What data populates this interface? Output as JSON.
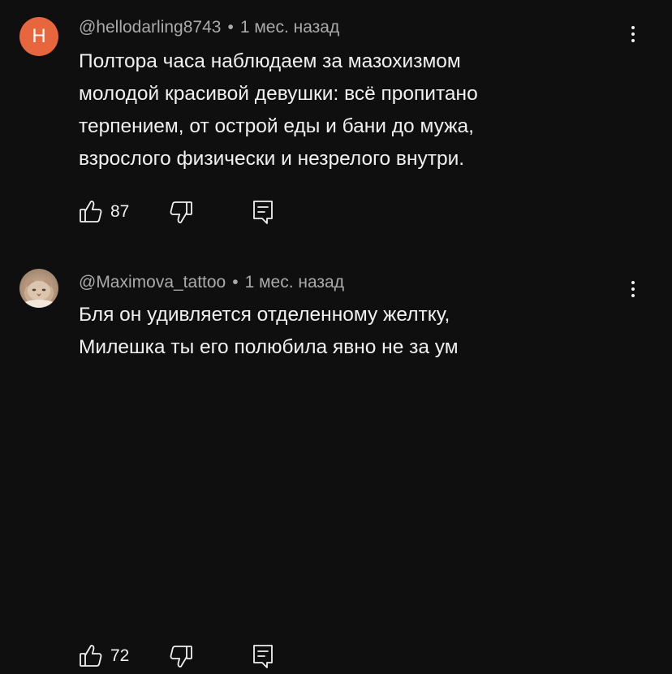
{
  "comments": [
    {
      "avatar_letter": "H",
      "avatar_color": "#e8663d",
      "author": "@hellodarling8743",
      "separator": "•",
      "time": "1 мес. назад",
      "lines": [
        "Полтора часа наблюдаем за мазохизмом",
        "молодой красивой девушки: всё пропитано",
        "терпением, от острой еды и бани до мужа,",
        "взрослого физически и незрелого внутри."
      ],
      "likes": "87",
      "icons": {
        "like": "thumb-up-icon",
        "dislike": "thumb-down-icon",
        "reply": "reply-icon",
        "menu": "more-vert-icon"
      }
    },
    {
      "avatar_letter": "",
      "author": "@Maximova_tattoo",
      "separator": "•",
      "time": "1 мес. назад",
      "lines": [
        "Бля он удивляется отделенному желтку,",
        "Милешка ты его полюбила явно не за ум"
      ],
      "likes": "72",
      "icons": {
        "like": "thumb-up-icon",
        "dislike": "thumb-down-icon",
        "reply": "reply-icon",
        "menu": "more-vert-icon"
      }
    }
  ],
  "colors": {
    "background": "#0f0f0f",
    "text": "#f1f1f1",
    "meta": "#aaaaaa"
  }
}
